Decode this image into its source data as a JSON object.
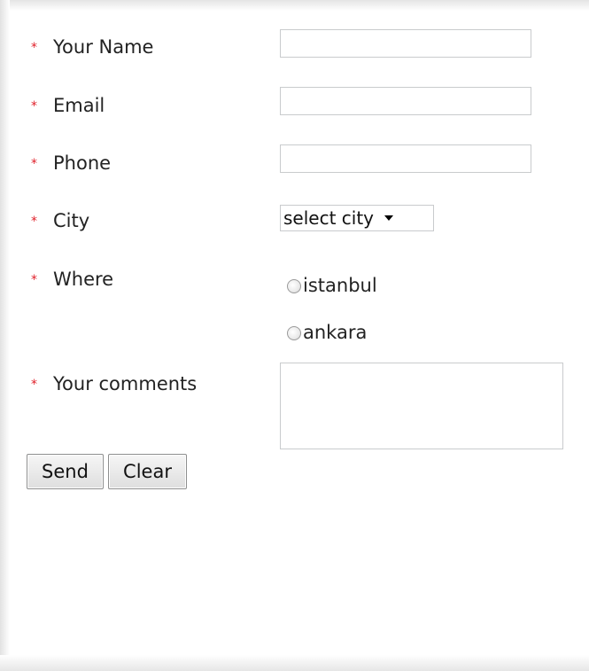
{
  "form": {
    "fields": [
      {
        "label": "Your Name",
        "required_mark": "*",
        "value": ""
      },
      {
        "label": "Email",
        "required_mark": "*",
        "value": ""
      },
      {
        "label": "Phone",
        "required_mark": "*",
        "value": ""
      },
      {
        "label": "City",
        "required_mark": "*"
      },
      {
        "label": "Where",
        "required_mark": "*"
      },
      {
        "label": "Your comments",
        "required_mark": "*",
        "value": ""
      }
    ],
    "city_select": {
      "selected": "select city"
    },
    "where_options": [
      {
        "label": "istanbul",
        "checked": false
      },
      {
        "label": "ankara",
        "checked": false
      }
    ],
    "buttons": {
      "send": "Send",
      "clear": "Clear"
    }
  },
  "colors": {
    "required": "#e0202a",
    "text": "#222222",
    "input_border": "#c9cbcd"
  }
}
